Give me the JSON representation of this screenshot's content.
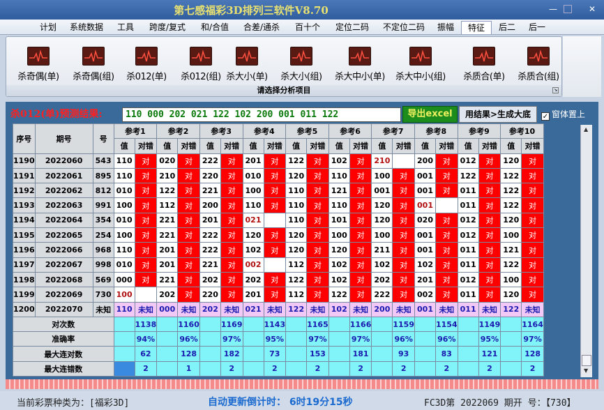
{
  "window": {
    "title": "第七感福彩3D排列三软件V8.70"
  },
  "menu": [
    "计划",
    "系统数据",
    "工具",
    "跨度/复式",
    "和/合值",
    "合差/通杀",
    "百十个",
    "定位二码",
    "不定位二码",
    "振幅",
    "特征",
    "后二",
    "后一"
  ],
  "active_menu": "特征",
  "ribbon": {
    "buttons": [
      {
        "label": "杀奇偶(单)"
      },
      {
        "label": "杀奇偶(组)"
      },
      {
        "label": "杀012(单)"
      },
      {
        "label": "杀012(组)"
      },
      {
        "label": "杀大小(单)"
      },
      {
        "label": "杀大小(组)"
      },
      {
        "label": "杀大中小(单)"
      },
      {
        "label": "杀大中小(组)"
      },
      {
        "label": "杀质合(单)"
      },
      {
        "label": "杀质合(组)"
      }
    ],
    "caption": "请选择分析项目"
  },
  "result": {
    "label": "杀012(单)预测结果:",
    "value": "110 000 202 021 122 102 200 001 011 122"
  },
  "buttons": {
    "export": "导出excel",
    "generate": "用结果>生成大底"
  },
  "topmost": {
    "label": "窗体置上",
    "checked": true,
    "mark": "✓"
  },
  "table": {
    "headers": {
      "seq": "序号",
      "issue": "期号",
      "num": "号",
      "refs": [
        "参考1",
        "参考2",
        "参考3",
        "参考4",
        "参考5",
        "参考6",
        "参考7",
        "参考8",
        "参考9",
        "参考10"
      ],
      "val": "值",
      "hit": "对错"
    },
    "rows": [
      {
        "seq": "1190",
        "issue": "2022060",
        "num": "543",
        "cells": [
          [
            "110",
            "对"
          ],
          [
            "020",
            "对"
          ],
          [
            "222",
            "对"
          ],
          [
            "201",
            "对"
          ],
          [
            "122",
            "对"
          ],
          [
            "102",
            "对"
          ],
          [
            "210",
            ""
          ],
          [
            "200",
            "对"
          ],
          [
            "012",
            "对"
          ],
          [
            "120",
            "对"
          ]
        ]
      },
      {
        "seq": "1191",
        "issue": "2022061",
        "num": "895",
        "cells": [
          [
            "110",
            "对"
          ],
          [
            "210",
            "对"
          ],
          [
            "220",
            "对"
          ],
          [
            "010",
            "对"
          ],
          [
            "120",
            "对"
          ],
          [
            "110",
            "对"
          ],
          [
            "100",
            "对"
          ],
          [
            "001",
            "对"
          ],
          [
            "122",
            "对"
          ],
          [
            "122",
            "对"
          ]
        ]
      },
      {
        "seq": "1192",
        "issue": "2022062",
        "num": "812",
        "cells": [
          [
            "010",
            "对"
          ],
          [
            "122",
            "对"
          ],
          [
            "221",
            "对"
          ],
          [
            "100",
            "对"
          ],
          [
            "110",
            "对"
          ],
          [
            "121",
            "对"
          ],
          [
            "001",
            "对"
          ],
          [
            "001",
            "对"
          ],
          [
            "011",
            "对"
          ],
          [
            "122",
            "对"
          ]
        ]
      },
      {
        "seq": "1193",
        "issue": "2022063",
        "num": "991",
        "cells": [
          [
            "100",
            "对"
          ],
          [
            "112",
            "对"
          ],
          [
            "200",
            "对"
          ],
          [
            "110",
            "对"
          ],
          [
            "110",
            "对"
          ],
          [
            "110",
            "对"
          ],
          [
            "120",
            "对"
          ],
          [
            "001",
            ""
          ],
          [
            "011",
            "对"
          ],
          [
            "122",
            "对"
          ]
        ]
      },
      {
        "seq": "1194",
        "issue": "2022064",
        "num": "354",
        "cells": [
          [
            "010",
            "对"
          ],
          [
            "221",
            "对"
          ],
          [
            "201",
            "对"
          ],
          [
            "021",
            ""
          ],
          [
            "110",
            "对"
          ],
          [
            "101",
            "对"
          ],
          [
            "120",
            "对"
          ],
          [
            "020",
            "对"
          ],
          [
            "012",
            "对"
          ],
          [
            "120",
            "对"
          ]
        ]
      },
      {
        "seq": "1195",
        "issue": "2022065",
        "num": "254",
        "cells": [
          [
            "100",
            "对"
          ],
          [
            "221",
            "对"
          ],
          [
            "222",
            "对"
          ],
          [
            "120",
            "对"
          ],
          [
            "120",
            "对"
          ],
          [
            "100",
            "对"
          ],
          [
            "100",
            "对"
          ],
          [
            "001",
            "对"
          ],
          [
            "012",
            "对"
          ],
          [
            "100",
            "对"
          ]
        ]
      },
      {
        "seq": "1196",
        "issue": "2022066",
        "num": "968",
        "cells": [
          [
            "110",
            "对"
          ],
          [
            "201",
            "对"
          ],
          [
            "222",
            "对"
          ],
          [
            "102",
            "对"
          ],
          [
            "120",
            "对"
          ],
          [
            "120",
            "对"
          ],
          [
            "211",
            "对"
          ],
          [
            "001",
            "对"
          ],
          [
            "011",
            "对"
          ],
          [
            "121",
            "对"
          ]
        ]
      },
      {
        "seq": "1197",
        "issue": "2022067",
        "num": "998",
        "cells": [
          [
            "010",
            "对"
          ],
          [
            "201",
            "对"
          ],
          [
            "221",
            "对"
          ],
          [
            "002",
            ""
          ],
          [
            "112",
            "对"
          ],
          [
            "102",
            "对"
          ],
          [
            "102",
            "对"
          ],
          [
            "102",
            "对"
          ],
          [
            "011",
            "对"
          ],
          [
            "122",
            "对"
          ]
        ]
      },
      {
        "seq": "1198",
        "issue": "2022068",
        "num": "569",
        "cells": [
          [
            "000",
            "对"
          ],
          [
            "221",
            "对"
          ],
          [
            "202",
            "对"
          ],
          [
            "202",
            "对"
          ],
          [
            "122",
            "对"
          ],
          [
            "102",
            "对"
          ],
          [
            "202",
            "对"
          ],
          [
            "201",
            "对"
          ],
          [
            "012",
            "对"
          ],
          [
            "100",
            "对"
          ]
        ]
      },
      {
        "seq": "1199",
        "issue": "2022069",
        "num": "730",
        "cells": [
          [
            "100",
            ""
          ],
          [
            "202",
            "对"
          ],
          [
            "220",
            "对"
          ],
          [
            "201",
            "对"
          ],
          [
            "112",
            "对"
          ],
          [
            "122",
            "对"
          ],
          [
            "222",
            "对"
          ],
          [
            "002",
            "对"
          ],
          [
            "011",
            "对"
          ],
          [
            "120",
            "对"
          ]
        ]
      }
    ],
    "pred": {
      "seq": "1200",
      "issue": "2022070",
      "num": "未知",
      "cells": [
        [
          "110",
          "未知"
        ],
        [
          "000",
          "未知"
        ],
        [
          "202",
          "未知"
        ],
        [
          "021",
          "未知"
        ],
        [
          "122",
          "未知"
        ],
        [
          "102",
          "未知"
        ],
        [
          "200",
          "未知"
        ],
        [
          "001",
          "未知"
        ],
        [
          "011",
          "未知"
        ],
        [
          "122",
          "未知"
        ]
      ]
    },
    "stats": [
      {
        "label": "对次数",
        "values": [
          "1138",
          "1160",
          "1169",
          "1143",
          "1165",
          "1166",
          "1159",
          "1154",
          "1149",
          "1164"
        ]
      },
      {
        "label": "准确率",
        "values": [
          "94%",
          "96%",
          "97%",
          "95%",
          "97%",
          "97%",
          "96%",
          "96%",
          "95%",
          "97%"
        ]
      },
      {
        "label": "最大连对数",
        "values": [
          "62",
          "128",
          "182",
          "73",
          "153",
          "181",
          "93",
          "83",
          "121",
          "128"
        ]
      },
      {
        "label": "最大连错数",
        "values": [
          "2",
          "1",
          "2",
          "2",
          "2",
          "2",
          "2",
          "2",
          "2",
          "2"
        ]
      }
    ]
  },
  "status": {
    "lottery": "当前彩票种类为：[福彩3D]",
    "countdown": "自动更新倒计时：  6时19分15秒",
    "issue": "FC3D第 2022069 期开  号：【730】"
  }
}
